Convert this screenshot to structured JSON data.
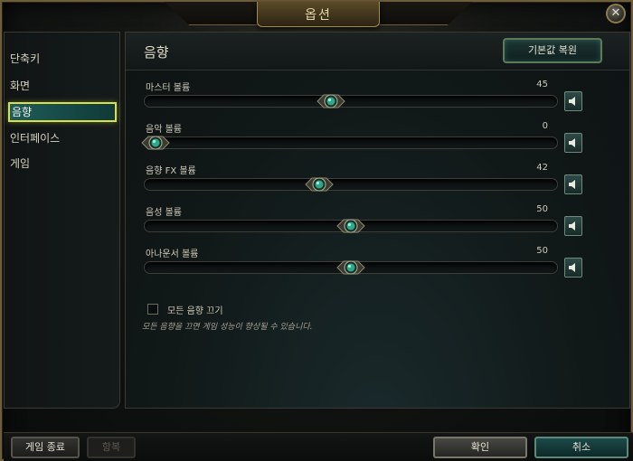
{
  "window": {
    "title": "옵션",
    "close_label": "✕"
  },
  "sidebar": {
    "items": [
      {
        "label": "단축키",
        "active": false
      },
      {
        "label": "화면",
        "active": false
      },
      {
        "label": "음향",
        "active": true
      },
      {
        "label": "인터페이스",
        "active": false
      },
      {
        "label": "게임",
        "active": false
      }
    ]
  },
  "main": {
    "title": "음향",
    "reset_label": "기본값 복원",
    "sliders": [
      {
        "label": "마스터 볼륨",
        "value": "45",
        "fraction": 0.45
      },
      {
        "label": "음악 볼륨",
        "value": "0",
        "fraction": 0.0
      },
      {
        "label": "음향 FX 볼륨",
        "value": "42",
        "fraction": 0.42
      },
      {
        "label": "음성 볼륨",
        "value": "50",
        "fraction": 0.5
      },
      {
        "label": "아나운서 볼륨",
        "value": "50",
        "fraction": 0.5
      }
    ],
    "mute_all": {
      "label": "모든 음향 끄기",
      "checked": false
    },
    "hint": "모든 음향을 끄면 게임 성능이 향상될 수 있습니다."
  },
  "bottom": {
    "quit_label": "게임 종료",
    "surrender_label": "항복",
    "confirm_label": "확인",
    "cancel_label": "취소"
  },
  "colors": {
    "accent": "#d8e04a",
    "teal": "#1f5c5a",
    "gold": "#a08a52"
  },
  "icons": {
    "mute": "speaker-icon",
    "thumb": "jewel-knob-icon",
    "close": "close-icon"
  }
}
